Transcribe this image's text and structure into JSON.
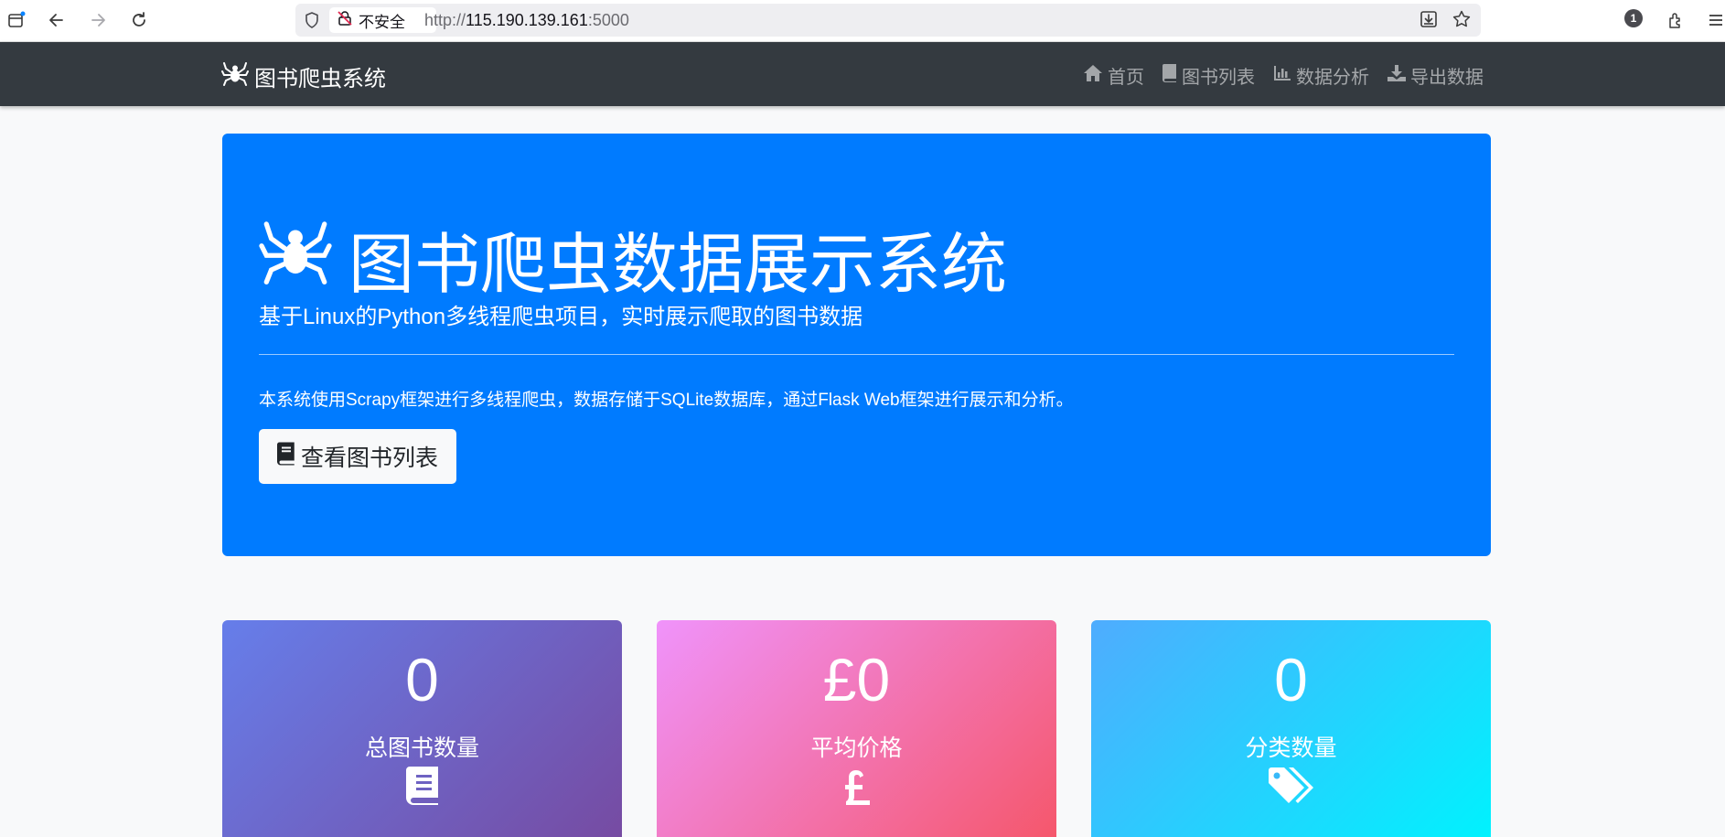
{
  "browser": {
    "security_label": "不安全",
    "url_scheme": "http://",
    "url_host": "115.190.139.161",
    "url_port": ":5000",
    "notification_count": "1"
  },
  "navbar": {
    "brand": "图书爬虫系统",
    "links": [
      {
        "label": "首页",
        "icon": "home-icon"
      },
      {
        "label": "图书列表",
        "icon": "book-icon"
      },
      {
        "label": "数据分析",
        "icon": "bar-chart-icon"
      },
      {
        "label": "导出数据",
        "icon": "download-icon"
      }
    ]
  },
  "hero": {
    "title": "图书爬虫数据展示系统",
    "lead": "基于Linux的Python多线程爬虫项目，实时展示爬取的图书数据",
    "description": "本系统使用Scrapy框架进行多线程爬虫，数据存储于SQLite数据库，通过Flask Web框架进行展示和分析。",
    "button_label": "查看图书列表"
  },
  "stats": [
    {
      "value": "0",
      "label": "总图书数量",
      "icon": "book-icon"
    },
    {
      "value": "£0",
      "label": "平均价格",
      "icon": "pound-icon"
    },
    {
      "value": "0",
      "label": "分类数量",
      "icon": "tags-icon"
    }
  ],
  "colors": {
    "navbar_bg": "#343a40",
    "hero_bg": "#007bff",
    "card1_gradient": [
      "#667eea",
      "#764ba2"
    ],
    "card2_gradient": [
      "#f093fb",
      "#f5576c"
    ],
    "card3_gradient": [
      "#4facfe",
      "#00f2fe"
    ]
  }
}
